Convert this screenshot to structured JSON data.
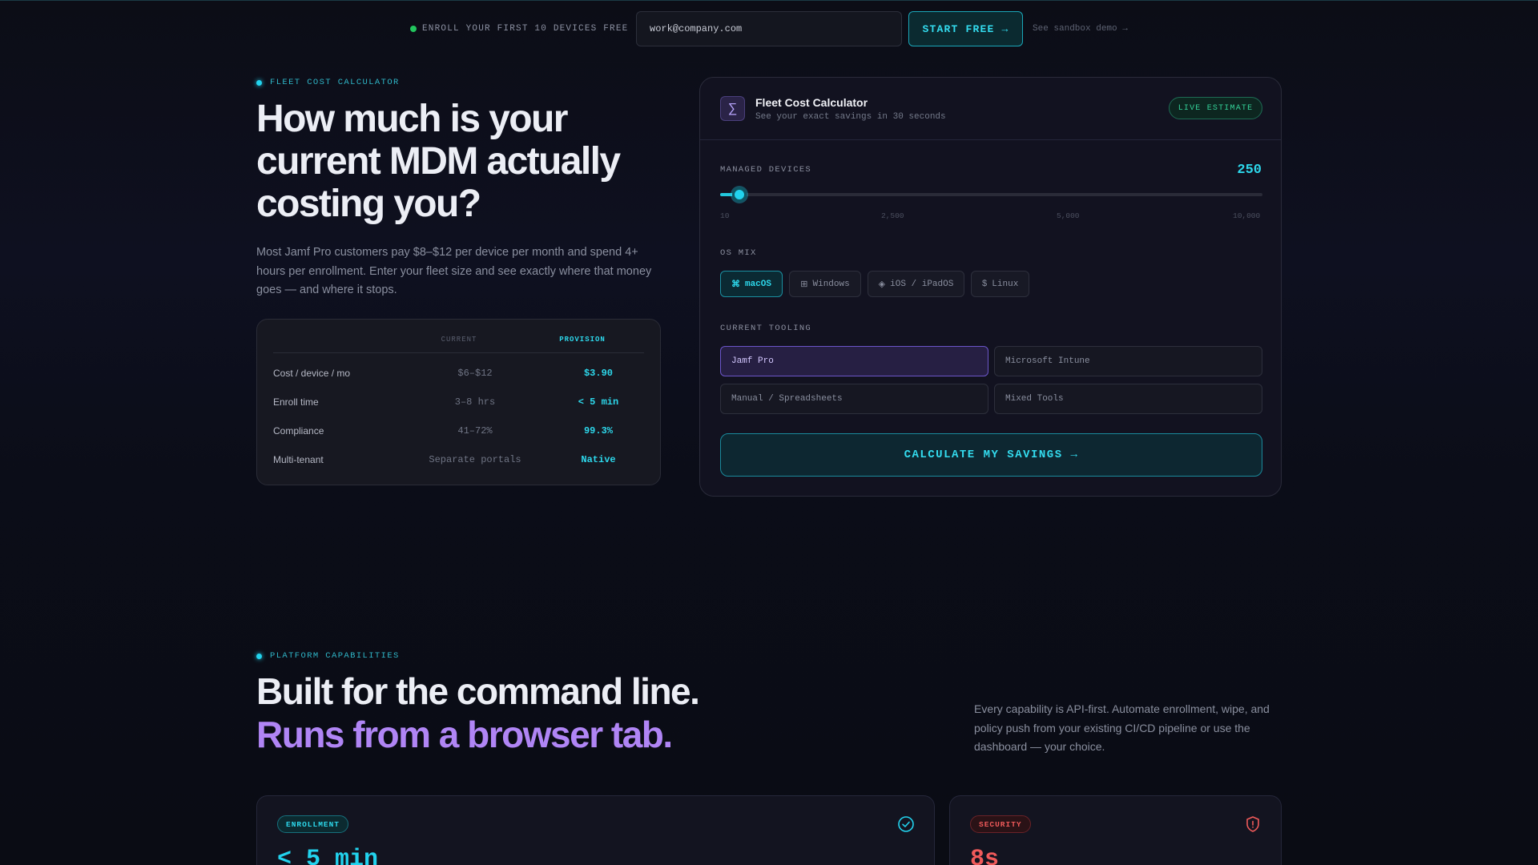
{
  "topbar": {
    "enroll_note": "ENROLL YOUR FIRST 10 DEVICES FREE",
    "email_value": "work@company.com",
    "start_label": "START FREE →",
    "sandbox_label": "See sandbox demo →"
  },
  "hero": {
    "eyebrow": "FLEET COST CALCULATOR",
    "title": "How much is your current MDM actually costing you?",
    "description": "Most Jamf Pro customers pay $8–$12 per device per month and spend 4+ hours per enrollment. Enter your fleet size and see exactly where that money goes — and where it stops."
  },
  "comparison": {
    "col_current": "CURRENT",
    "col_provision": "PROVISION",
    "rows": [
      {
        "label": "Cost / device / mo",
        "current": "$6–$12",
        "provision": "$3.90"
      },
      {
        "label": "Enroll time",
        "current": "3–8 hrs",
        "provision": "< 5 min"
      },
      {
        "label": "Compliance",
        "current": "41–72%",
        "provision": "99.3%"
      },
      {
        "label": "Multi-tenant",
        "current": "Separate portals",
        "provision": "Native"
      }
    ]
  },
  "calculator": {
    "icon": "∑",
    "title": "Fleet Cost Calculator",
    "subtitle": "See your exact savings in 30 seconds",
    "badge": "LIVE ESTIMATE",
    "devices_label": "MANAGED DEVICES",
    "devices_value": "250",
    "slider": {
      "min": 10,
      "max": 10000,
      "value": 250
    },
    "ticks": [
      "10",
      "2,500",
      "5,000",
      "10,000"
    ],
    "os_label": "OS MIX",
    "os_options": [
      {
        "glyph": "⌘",
        "label": "macOS",
        "active": true
      },
      {
        "glyph": "⊞",
        "label": "Windows",
        "active": false
      },
      {
        "glyph": "◈",
        "label": "iOS / iPadOS",
        "active": false
      },
      {
        "glyph": "$",
        "label": "Linux",
        "active": false
      }
    ],
    "tooling_label": "CURRENT TOOLING",
    "tooling_options": [
      {
        "label": "Jamf Pro",
        "active": true
      },
      {
        "label": "Microsoft Intune",
        "active": false
      },
      {
        "label": "Manual / Spreadsheets",
        "active": false
      },
      {
        "label": "Mixed Tools",
        "active": false
      }
    ],
    "cta": "CALCULATE MY SAVINGS →"
  },
  "capabilities": {
    "eyebrow": "PLATFORM CAPABILITIES",
    "title_line1": "Built for the command line.",
    "title_line2": "Runs from a browser tab.",
    "description": "Every capability is API-first. Automate enrollment, wipe, and policy push from your existing CI/CD pipeline or use the dashboard — your choice.",
    "cards": [
      {
        "badge": "ENROLLMENT",
        "metric": "< 5 min",
        "icon": "check-circle-icon",
        "color": "#22d3ee"
      },
      {
        "badge": "SECURITY",
        "metric": "8s",
        "icon": "shield-alert-icon",
        "color": "#f05a5a"
      }
    ]
  }
}
